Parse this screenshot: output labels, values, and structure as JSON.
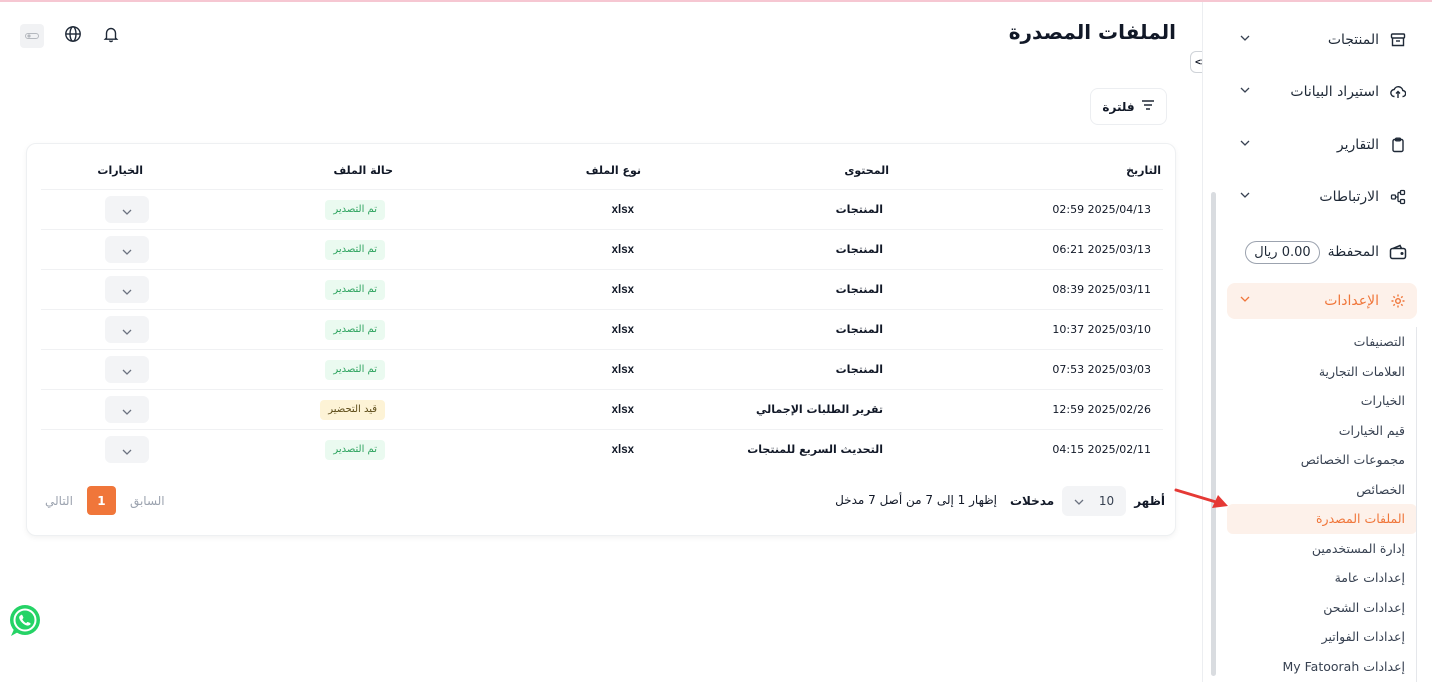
{
  "page": {
    "title": "الملفات المصدرة"
  },
  "header": {
    "icons": [
      "toggle-icon",
      "globe-icon",
      "bell-icon"
    ]
  },
  "sidebar": {
    "items": [
      {
        "label": "المنتجات",
        "icon": "archive-icon"
      },
      {
        "label": "استيراد البيانات",
        "icon": "cloud-upload-icon"
      },
      {
        "label": "التقارير",
        "icon": "clipboard-icon"
      },
      {
        "label": "الارتباطات",
        "icon": "share-nodes-icon"
      },
      {
        "label": "المحفظة",
        "icon": "wallet-icon",
        "badge": "0.00 ريال"
      },
      {
        "label": "الإعدادات",
        "icon": "gear-icon",
        "active": true
      }
    ],
    "submenu": [
      {
        "label": "التصنيفات"
      },
      {
        "label": "العلامات التجارية"
      },
      {
        "label": "الخيارات"
      },
      {
        "label": "قيم الخيارات"
      },
      {
        "label": "مجموعات الخصائص"
      },
      {
        "label": "الخصائص"
      },
      {
        "label": "الملفات المصدرة",
        "active": true
      },
      {
        "label": "إدارة المستخدمين"
      },
      {
        "label": "إعدادات عامة"
      },
      {
        "label": "إعدادات الشحن"
      },
      {
        "label": "إعدادات الفواتير"
      },
      {
        "label": "إعدادات My Fatoorah"
      }
    ]
  },
  "filter": {
    "label": "فلترة"
  },
  "table": {
    "headers": {
      "date": "التاريخ",
      "content": "المحتوى",
      "type": "نوع الملف",
      "status": "حالة الملف",
      "options": "الخيارات"
    },
    "rows": [
      {
        "date": "2025/04/13 02:59",
        "content": "المنتجات",
        "type": "xlsx",
        "status": "تم التصدير",
        "status_kind": "done"
      },
      {
        "date": "2025/03/13 06:21",
        "content": "المنتجات",
        "type": "xlsx",
        "status": "تم التصدير",
        "status_kind": "done"
      },
      {
        "date": "2025/03/11 08:39",
        "content": "المنتجات",
        "type": "xlsx",
        "status": "تم التصدير",
        "status_kind": "done"
      },
      {
        "date": "2025/03/10 10:37",
        "content": "المنتجات",
        "type": "xlsx",
        "status": "تم التصدير",
        "status_kind": "done"
      },
      {
        "date": "2025/03/03 07:53",
        "content": "المنتجات",
        "type": "xlsx",
        "status": "تم التصدير",
        "status_kind": "done"
      },
      {
        "date": "2025/02/26 12:59",
        "content": "تقرير الطلبات الإجمالي",
        "type": "xlsx",
        "status": "قيد التحضير",
        "status_kind": "prep"
      },
      {
        "date": "2025/02/11 04:15",
        "content": "التحديث السريع للمنتجات",
        "type": "xlsx",
        "status": "تم التصدير",
        "status_kind": "done"
      }
    ]
  },
  "footer": {
    "show_label": "أظهر",
    "per_page": "10",
    "entries_label": "مدخلات",
    "showing_text": "إظهار 1 إلى 7 من أصل 7 مدخل",
    "prev_label": "السابق",
    "next_label": "التالي",
    "current_page": "1"
  },
  "colors": {
    "accent": "#f0763a",
    "success": "#2ea35f",
    "warning_bg": "#fdf3d6",
    "arrow": "#e53935",
    "whatsapp": "#25d366"
  }
}
